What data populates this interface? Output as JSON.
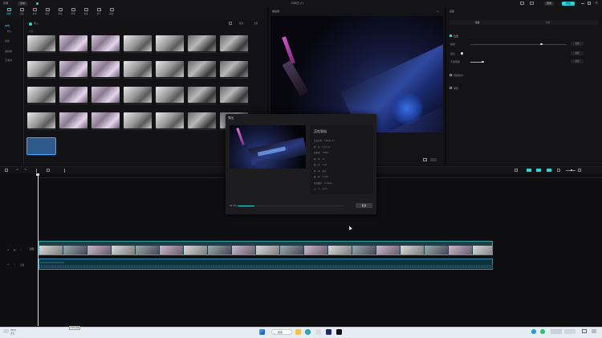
{
  "app": {
    "menu_label": "剪映",
    "menu_badge": "菜单",
    "window_title": "7月8日 (1)",
    "login_button": "登录",
    "export_button": "导出"
  },
  "toolbar": {
    "tools": [
      {
        "label": "媒体",
        "active": true
      },
      {
        "label": "音频"
      },
      {
        "label": "文本"
      },
      {
        "label": "贴纸"
      },
      {
        "label": "特效"
      },
      {
        "label": "转场"
      },
      {
        "label": "滤镜"
      },
      {
        "label": "调节"
      },
      {
        "label": "模板"
      }
    ]
  },
  "media": {
    "sidebar": [
      "本地",
      "导入",
      "我的",
      "素材库",
      "云素材"
    ],
    "import_label": "导入",
    "sort_label": "全部",
    "filter_label": "筛选"
  },
  "player": {
    "title": "播放器"
  },
  "properties": {
    "title": "画面",
    "tabs": [
      "基础",
      "抠像"
    ],
    "section_position": "位置",
    "scale_label": "缩放",
    "opacity_label": "混合",
    "blend_label": "不透明度",
    "reset_label": "重置",
    "section_stabilize": "视频防抖",
    "section_beauty": "美颜"
  },
  "export_dialog": {
    "title": "导出",
    "status": "正在导出",
    "info": [
      {
        "k": "作品名称",
        "v": "7月8日 (1)"
      },
      {
        "k": "时　长",
        "v": "6:09:45"
      },
      {
        "k": "分辨率",
        "v": "1080P"
      },
      {
        "k": "帧　率",
        "v": "30"
      },
      {
        "k": "格　式",
        "v": "mp4"
      },
      {
        "k": "码　率",
        "v": "推荐"
      },
      {
        "k": "编　码",
        "v": "H.264"
      },
      {
        "k": "导出路径",
        "v": "D:/剪映/..."
      },
      {
        "k": "大　小",
        "v": "约2G"
      }
    ],
    "progress_label": "16.1%",
    "progress": 0.161,
    "cancel_label": "取消"
  },
  "timeline": {
    "video_track_label": "封面",
    "audio_track_label": "音频"
  },
  "taskbar": {
    "weather_temp": "28°C",
    "weather_desc": "多云",
    "search_label": "搜索",
    "tooltip": "Ctrl+Alt"
  }
}
